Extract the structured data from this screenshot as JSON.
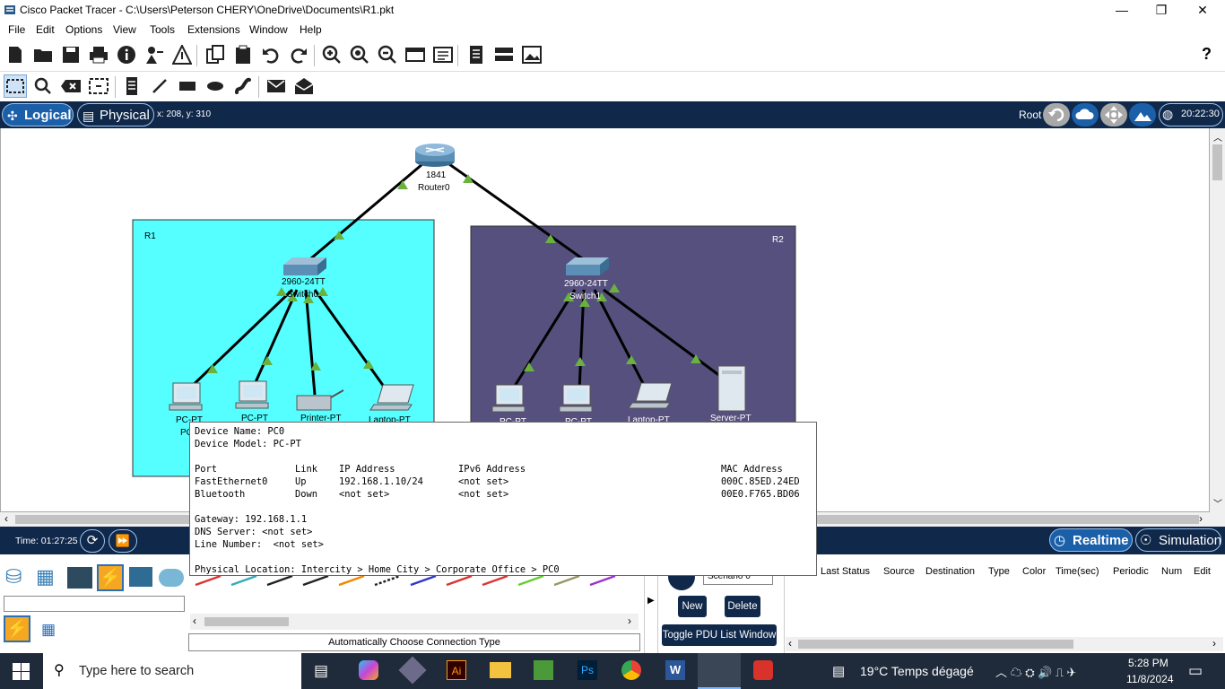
{
  "window": {
    "title": "Cisco Packet Tracer - C:\\Users\\Peterson CHERY\\OneDrive\\Documents\\R1.pkt",
    "minimize": "—",
    "restore": "❐",
    "close": "✕"
  },
  "menu": [
    "File",
    "Edit",
    "Options",
    "View",
    "Tools",
    "Extensions",
    "Window",
    "Help"
  ],
  "help_label": "?",
  "viewbar": {
    "logical": "Logical",
    "physical": "Physical",
    "coords": "x: 208, y: 310",
    "root": "Root",
    "clock": "20:22:30"
  },
  "topology": {
    "router": {
      "model": "1841",
      "name": "Router0"
    },
    "area1": {
      "label": "R1",
      "color": "#55ffff"
    },
    "area2": {
      "label": "R2",
      "color": "#56507e"
    },
    "switch0": {
      "model": "2960-24TT",
      "name": "Switch0"
    },
    "switch1": {
      "model": "2960-24TT",
      "name": "Switch1"
    },
    "r1_devices": [
      "PC-PT",
      "PC-PT",
      "Printer-PT",
      "Laptop-PT"
    ],
    "r1_pc_name": "PC",
    "r2_devices": [
      "PC-PT",
      "PC-PT",
      "Laptop-PT",
      "Server-PT"
    ],
    "link_color": "#000000",
    "link_up_color": "#6ab23e"
  },
  "tooltip": {
    "device_name": "Device Name: PC0",
    "device_model": "Device Model: PC-PT",
    "headers": {
      "port": "Port",
      "link": "Link",
      "ip": "IP Address",
      "ipv6": "IPv6 Address",
      "mac": "MAC Address"
    },
    "ports": [
      {
        "port": "FastEthernet0",
        "link": "Up",
        "ip": "192.168.1.10/24",
        "ipv6": "<not set>",
        "mac": "000C.85ED.24ED"
      },
      {
        "port": "Bluetooth",
        "link": "Down",
        "ip": "<not set>",
        "ipv6": "<not set>",
        "mac": "00E0.F765.BD06"
      }
    ],
    "gateway": "Gateway: 192.168.1.1",
    "dns": "DNS Server: <not set>",
    "line_number": "Line Number:  <not set>",
    "location": "Physical Location: Intercity > Home City > Corporate Office > PC0"
  },
  "timebar": {
    "time": "Time: 01:27:25",
    "realtime": "Realtime",
    "simulation": "Simulation"
  },
  "bottom": {
    "connection_type": "Automatically Choose Connection Type",
    "scenario": "Scenario 0",
    "new_label": "New",
    "delete_label": "Delete",
    "toggle_pdu": "Toggle PDU List Window",
    "pdu_columns": [
      "Last Status",
      "Source",
      "Destination",
      "Type",
      "Color",
      "Time(sec)",
      "Periodic",
      "Num",
      "Edit"
    ]
  },
  "taskbar": {
    "search_placeholder": "Type here to search",
    "weather": "19°C  Temps dégagé",
    "time": "5:28 PM",
    "date": "11/8/2024"
  }
}
